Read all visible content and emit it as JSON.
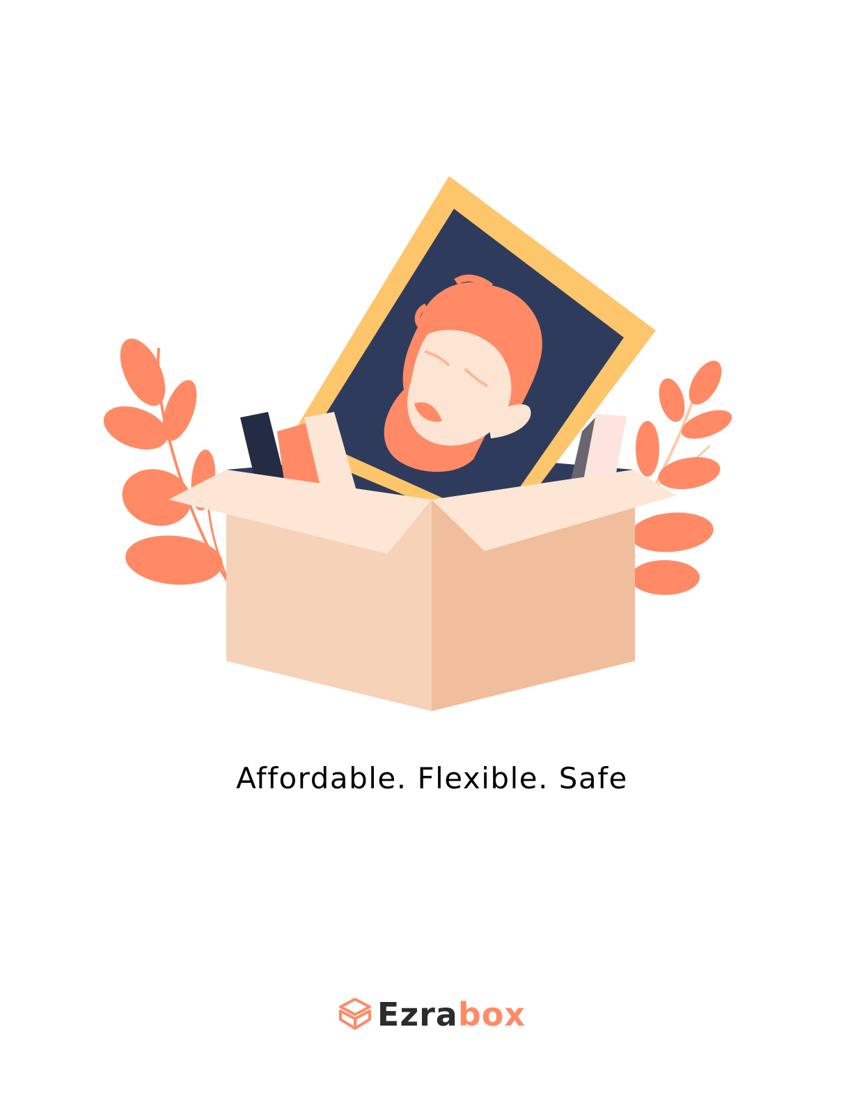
{
  "tagline": "Affordable. Flexible. Safe",
  "brand": {
    "name_dark": "Ezra",
    "name_accent": "box"
  },
  "colors": {
    "leaf": "#ff8a65",
    "leaf_stem": "#ffc8a8",
    "frame": "#fdc66b",
    "canvas": "#2f3b5c",
    "hair": "#ff8a65",
    "skin": "#fde4d3",
    "box_front_left": "#f6d2b9",
    "box_front_right": "#f0be9c",
    "box_flap": "#fde6d5",
    "brand_dark": "#2c2c2c",
    "brand_accent": "#ff8a65"
  },
  "icons": {
    "logo": "box-logo-icon"
  }
}
